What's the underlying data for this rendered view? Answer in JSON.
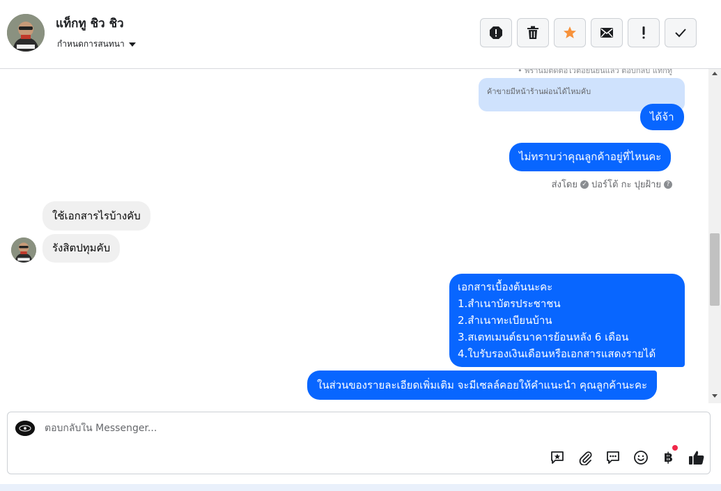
{
  "header": {
    "contact_name": "แท็กทู ชิว ชิว",
    "assign_label": "กำหนดการสนทนา",
    "actions": [
      {
        "icon": "alert-icon",
        "name": "spam-button"
      },
      {
        "icon": "trash-icon",
        "name": "delete-button"
      },
      {
        "icon": "star-icon",
        "name": "star-button"
      },
      {
        "icon": "mail-icon",
        "name": "mark-unread-button"
      },
      {
        "icon": "exclamation-icon",
        "name": "follow-up-button"
      },
      {
        "icon": "check-icon",
        "name": "mark-done-button"
      }
    ]
  },
  "conversation": {
    "cut_text": "• พี่ร้านมีติดต่อไว้ต่อยืนยันแล้ว ตอบกลับ แท็กทู",
    "reply_quote": "ค้าขายมีหน้าร้านผ่อนได้ไหมคับ",
    "messages": [
      {
        "direction": "outgoing",
        "text": "ได้จ้า"
      },
      {
        "direction": "outgoing",
        "text": "ไม่ทราบว่าคุณลูกค้าอยู่ที่ไหนคะ"
      },
      {
        "direction": "incoming",
        "text": "ใช้เอกสารไรบ้างคับ"
      },
      {
        "direction": "incoming",
        "text": "รังสิตปทุมคับ"
      },
      {
        "direction": "outgoing",
        "lines": [
          "เอกสารเบื้องต้นนะคะ",
          "1.สำเนาบัตรประชาชน",
          "2.สำเนาทะเบียนบ้าน",
          "3.สเตทเมนต์ธนาคารย้อนหลัง 6 เดือน",
          "4.ใบรับรองเงินเดือนหรือเอกสารแสดงรายได้"
        ]
      },
      {
        "direction": "outgoing",
        "text": "ในส่วนของรายละเอียดเพิ่มเติม จะมีเซลล์คอยให้คำแนะนำ คุณลูกค้านะคะ"
      }
    ],
    "sent_by": {
      "prefix": "ส่งโดย",
      "name": "ปอร์โต้ กะ ปุยฝ้าย"
    }
  },
  "composer": {
    "placeholder": "ตอบกลับใน Messenger...",
    "baht_symbol": "฿",
    "tools": [
      "saved-reply-icon",
      "attachment-icon",
      "chat-icon",
      "emoji-icon",
      "payment-icon",
      "like-icon"
    ]
  },
  "colors": {
    "outgoing_bubble": "#0866ff",
    "incoming_bubble": "#f0f0f0",
    "reply_quote": "#cfe2fd",
    "notification_dot": "#f02849"
  }
}
